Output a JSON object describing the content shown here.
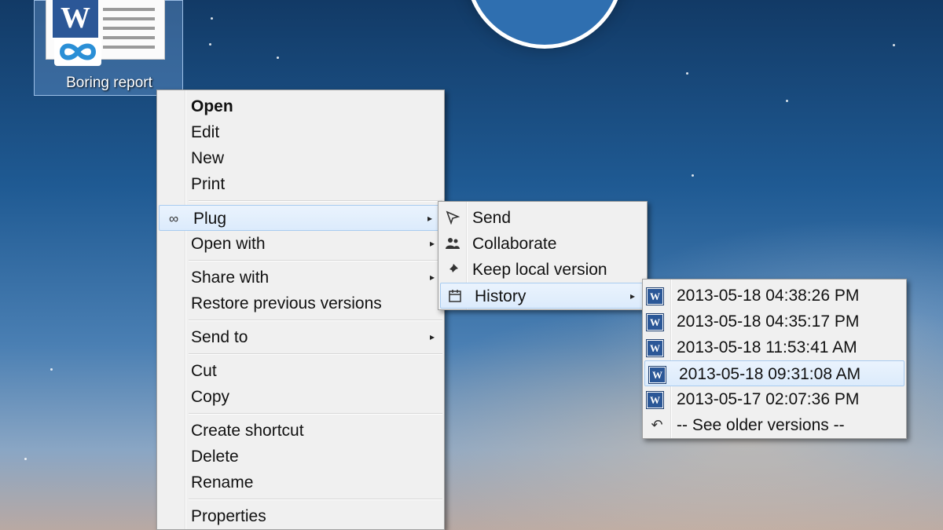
{
  "desktop": {
    "icon_label": "Boring report"
  },
  "context_menu": {
    "items": [
      {
        "label": "Open"
      },
      {
        "label": "Edit"
      },
      {
        "label": "New"
      },
      {
        "label": "Print"
      },
      {
        "label": "Plug"
      },
      {
        "label": "Open with"
      },
      {
        "label": "Share with"
      },
      {
        "label": "Restore previous versions"
      },
      {
        "label": "Send to"
      },
      {
        "label": "Cut"
      },
      {
        "label": "Copy"
      },
      {
        "label": "Create shortcut"
      },
      {
        "label": "Delete"
      },
      {
        "label": "Rename"
      },
      {
        "label": "Properties"
      }
    ]
  },
  "plug_submenu": {
    "items": [
      {
        "label": "Send",
        "icon": "send-icon"
      },
      {
        "label": "Collaborate",
        "icon": "collaborate-icon"
      },
      {
        "label": "Keep local version",
        "icon": "pin-icon"
      },
      {
        "label": "History",
        "icon": "calendar-icon"
      }
    ]
  },
  "history_submenu": {
    "items": [
      {
        "label": "2013-05-18 04:38:26 PM",
        "icon": "word-doc-icon"
      },
      {
        "label": "2013-05-18 04:35:17 PM",
        "icon": "word-doc-icon"
      },
      {
        "label": "2013-05-18 11:53:41 AM",
        "icon": "word-doc-icon"
      },
      {
        "label": "2013-05-18 09:31:08 AM",
        "icon": "word-doc-icon"
      },
      {
        "label": "2013-05-17 02:07:36 PM",
        "icon": "word-doc-icon"
      },
      {
        "label": "-- See older versions --",
        "icon": "undo-arrow-icon"
      }
    ]
  },
  "colors": {
    "menu_bg": "#f0f0f0",
    "highlight": "#dcebfc",
    "word_blue": "#2b5797",
    "plug_blue": "#2a8fd6"
  }
}
